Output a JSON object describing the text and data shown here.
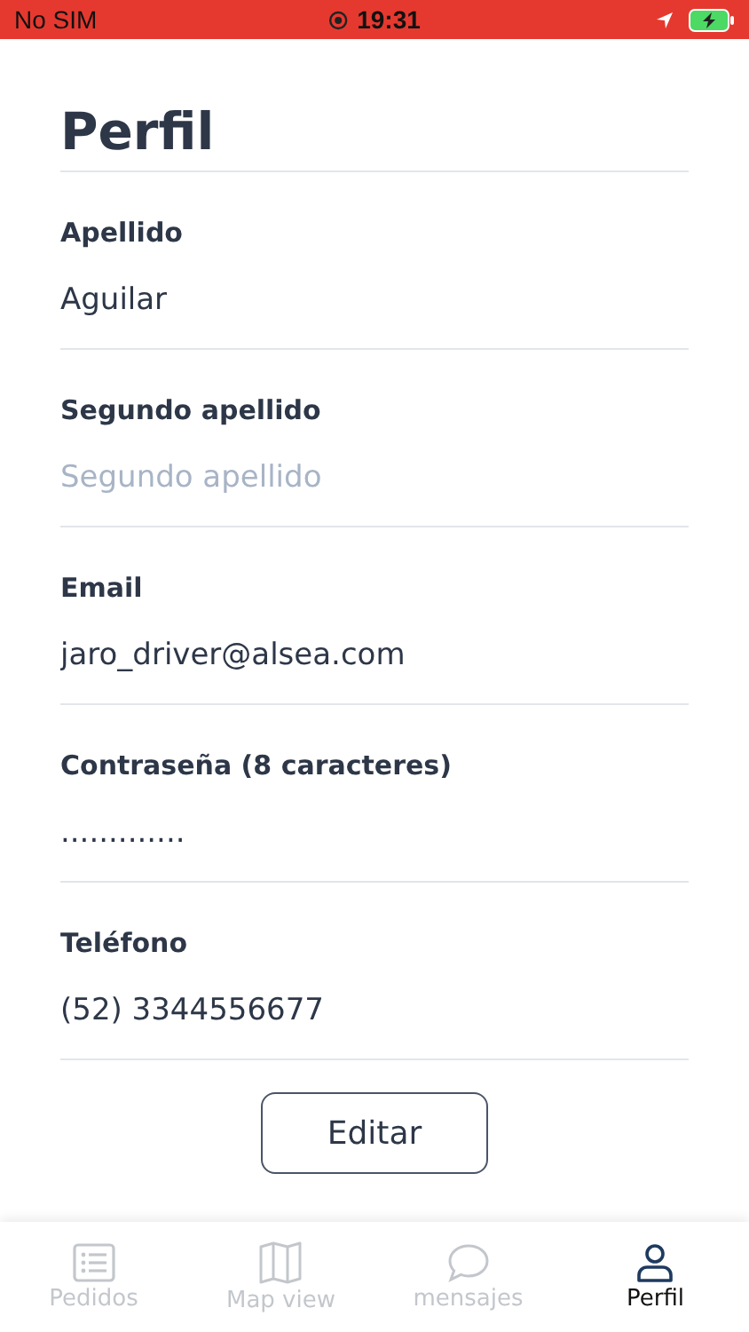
{
  "status_bar": {
    "carrier": "No SIM",
    "time": "19:31"
  },
  "title": "Perfil",
  "fields": [
    {
      "label": "Apellido",
      "value": "Aguilar"
    },
    {
      "label": "Segundo apellido",
      "placeholder": "Segundo apellido"
    },
    {
      "label": "Email",
      "value": "jaro_driver@alsea.com"
    },
    {
      "label": "Contraseña (8 caracteres)",
      "value": "............."
    },
    {
      "label": "Teléfono",
      "value": "(52) 3344556677"
    }
  ],
  "edit_button": "Editar",
  "tabs": [
    {
      "label": "Pedidos",
      "kind": "list",
      "selected": false
    },
    {
      "label": "Map view",
      "kind": "map",
      "selected": false
    },
    {
      "label": "mensajes",
      "kind": "chat",
      "selected": false
    },
    {
      "label": "Perfil",
      "kind": "person",
      "selected": true
    }
  ]
}
